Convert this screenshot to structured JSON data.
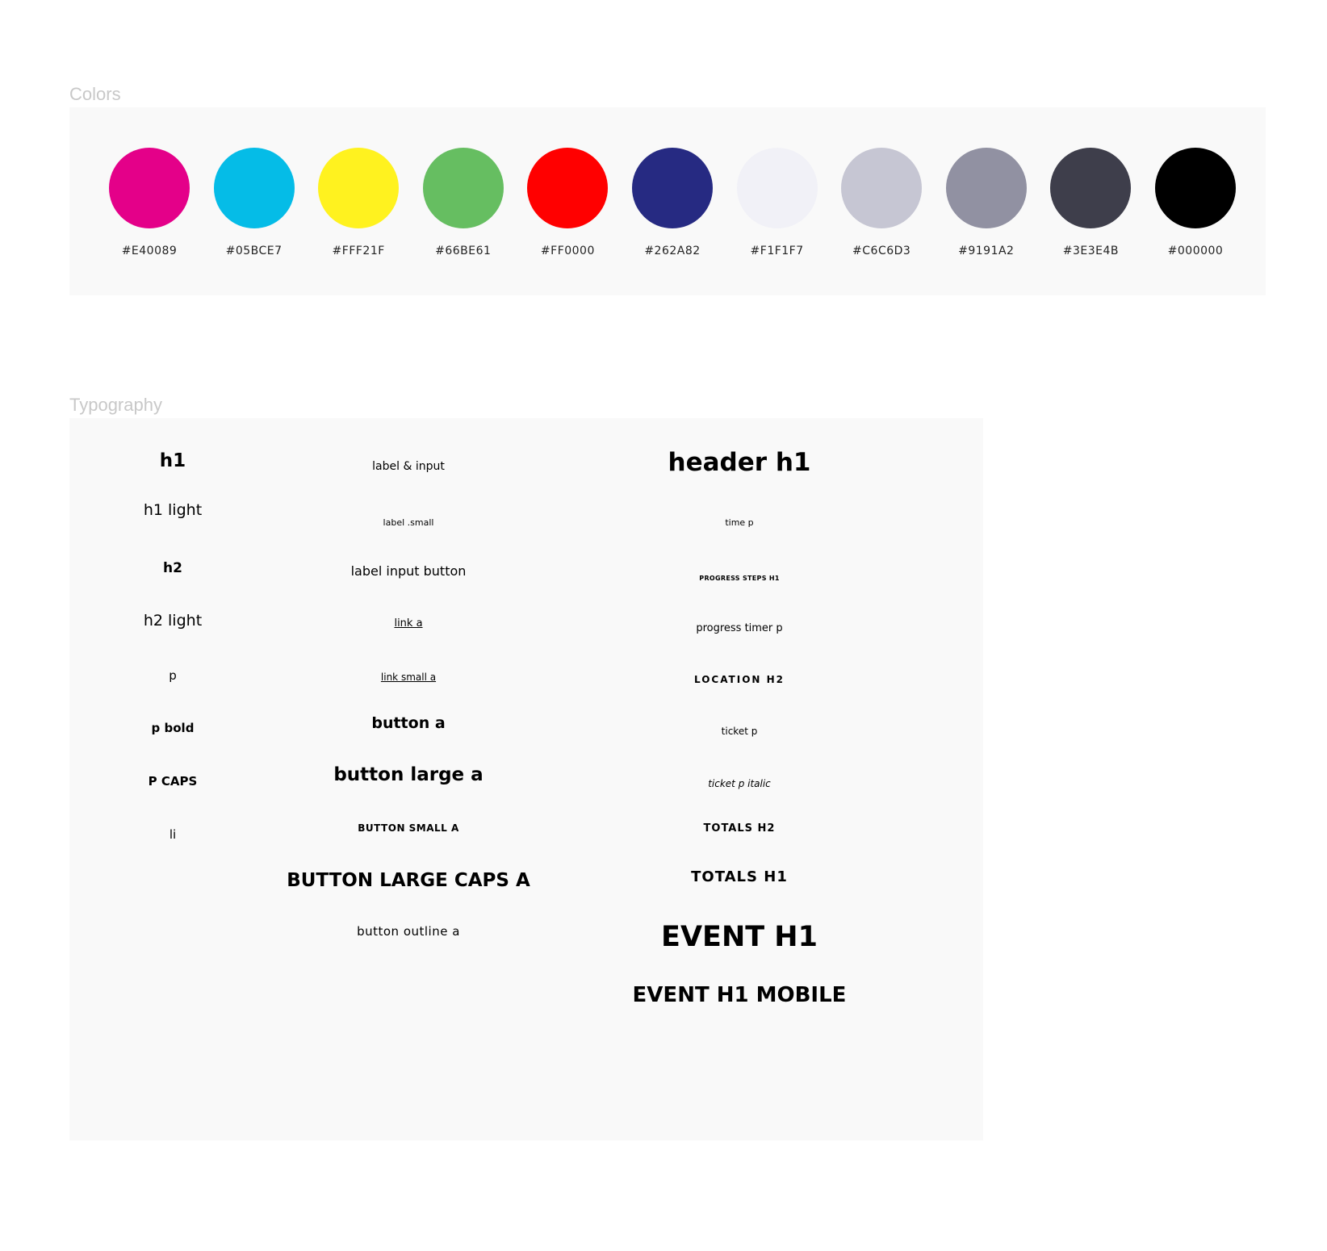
{
  "colors": {
    "title": "Colors",
    "swatches": [
      {
        "hex": "#E40089",
        "label": "#E40089"
      },
      {
        "hex": "#05BCE7",
        "label": "#05BCE7"
      },
      {
        "hex": "#FFF21F",
        "label": "#FFF21F"
      },
      {
        "hex": "#66BE61",
        "label": "#66BE61"
      },
      {
        "hex": "#FF0000",
        "label": "#FF0000"
      },
      {
        "hex": "#262A82",
        "label": "#262A82"
      },
      {
        "hex": "#F1F1F7",
        "label": "#F1F1F7"
      },
      {
        "hex": "#C6C6D3",
        "label": "#C6C6D3"
      },
      {
        "hex": "#9191A2",
        "label": "#9191A2"
      },
      {
        "hex": "#3E3E4B",
        "label": "#3E3E4B"
      },
      {
        "hex": "#000000",
        "label": "#000000"
      }
    ]
  },
  "typography": {
    "title": "Typography",
    "col1": {
      "h1": "h1",
      "h1_light": "h1 light",
      "h2": "h2",
      "h2_light": "h2 light",
      "p": "p",
      "p_bold": "p bold",
      "p_caps": "P CAPS",
      "li": "li"
    },
    "col2": {
      "label_input": "label & input",
      "label_small": "label .small",
      "label_input_button": "label input button",
      "link_a": "link a",
      "link_small_a": "link small a",
      "button_a": "button a",
      "button_large_a": "button large a",
      "button_small_a": "BUTTON SMALL A",
      "button_large_caps_a": "BUTTON LARGE CAPS A",
      "button_outline_a": "button outline a"
    },
    "col3": {
      "header_h1": "header h1",
      "time_p": "time p",
      "progress_steps_h1": "PROGRESS STEPS H1",
      "progress_timer_p": "progress timer p",
      "location_h2": "LOCATION H2",
      "ticket_p": "ticket p",
      "ticket_p_italic": "ticket p italic",
      "totals_h2": "TOTALS H2",
      "totals_h1": "TOTALS H1",
      "event_h1": "EVENT H1",
      "event_h1_mobile": "EVENT H1 MOBILE"
    }
  }
}
